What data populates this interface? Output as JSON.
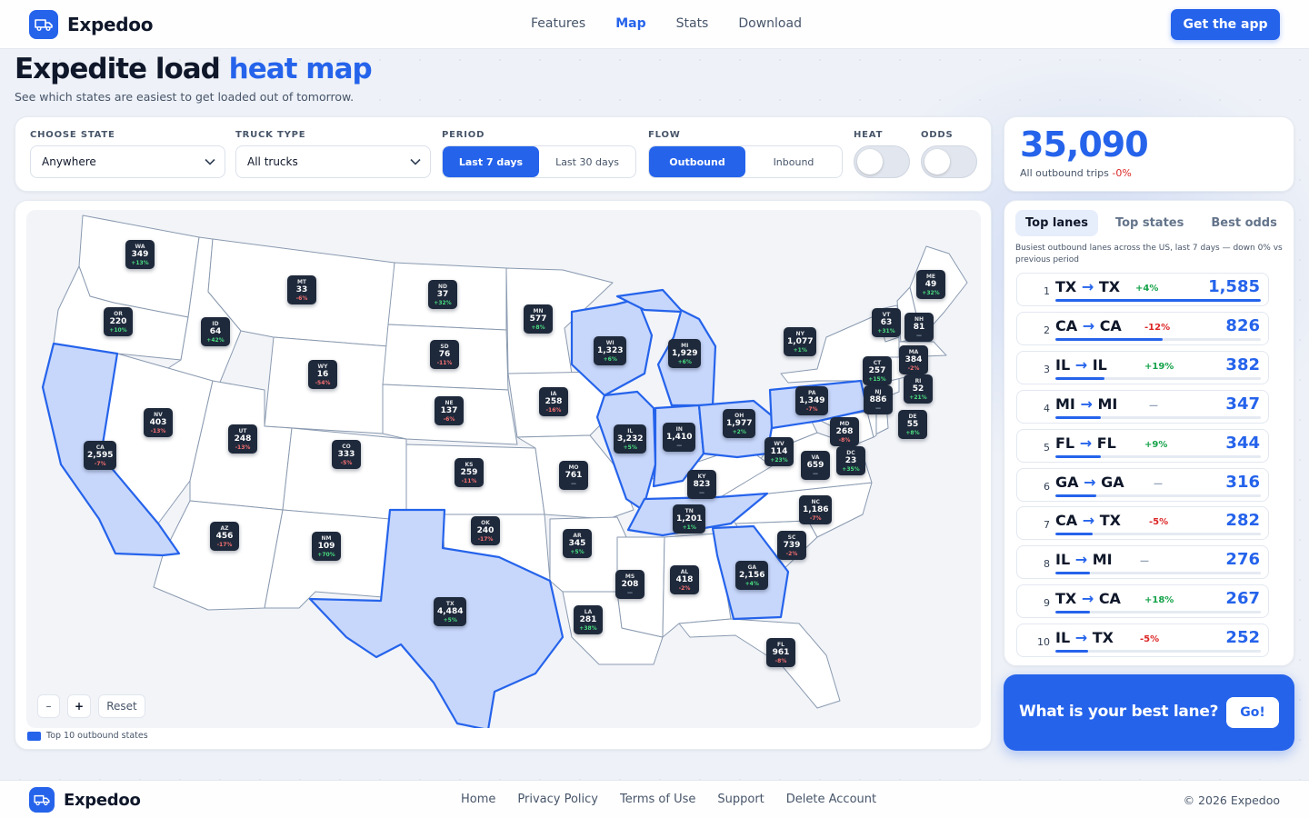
{
  "brand": {
    "name": "Expedoo",
    "accent": "#2563eb"
  },
  "nav": {
    "links": [
      "Features",
      "Map",
      "Stats",
      "Download"
    ],
    "active": "Map",
    "cta": "Get the app"
  },
  "hero": {
    "title_a": "Expedite load",
    "title_b": "heat map",
    "subtitle": "See which states are easiest to get loaded out of tomorrow."
  },
  "filters": {
    "state": {
      "label": "CHOOSE STATE",
      "value": "Anywhere"
    },
    "truck": {
      "label": "TRUCK TYPE",
      "value": "All trucks"
    },
    "period": {
      "label": "PERIOD",
      "options": [
        "Last 7 days",
        "Last 30 days"
      ],
      "selected": "Last 7 days"
    },
    "flow": {
      "label": "FLOW",
      "options": [
        "Outbound",
        "Inbound"
      ],
      "selected": "Outbound"
    },
    "heat": {
      "label": "HEAT",
      "on": false
    },
    "odds": {
      "label": "ODDS",
      "on": false
    }
  },
  "total": {
    "value": "35,090",
    "label": "All outbound trips",
    "change": "-0%"
  },
  "map": {
    "zoom_out": "–",
    "zoom_in": "+",
    "reset": "Reset",
    "legend": "Top 10 outbound states",
    "highlight_fill": "#c7d7fb",
    "highlight_stroke": "#2563eb",
    "states": [
      {
        "code": "WA",
        "value": "349",
        "change": "+13%"
      },
      {
        "code": "OR",
        "value": "220",
        "change": "+10%"
      },
      {
        "code": "CA",
        "value": "2,595",
        "change": "-7%",
        "top": true
      },
      {
        "code": "NV",
        "value": "403",
        "change": "-13%"
      },
      {
        "code": "ID",
        "value": "64",
        "change": "+42%"
      },
      {
        "code": "MT",
        "value": "33",
        "change": "-6%"
      },
      {
        "code": "WY",
        "value": "16",
        "change": "-54%"
      },
      {
        "code": "UT",
        "value": "248",
        "change": "-13%"
      },
      {
        "code": "CO",
        "value": "333",
        "change": "-5%"
      },
      {
        "code": "AZ",
        "value": "456",
        "change": "-17%"
      },
      {
        "code": "NM",
        "value": "109",
        "change": "+70%"
      },
      {
        "code": "ND",
        "value": "37",
        "change": "+32%"
      },
      {
        "code": "SD",
        "value": "76",
        "change": "-11%"
      },
      {
        "code": "NE",
        "value": "137",
        "change": "-6%"
      },
      {
        "code": "KS",
        "value": "259",
        "change": "-11%"
      },
      {
        "code": "OK",
        "value": "240",
        "change": "-17%"
      },
      {
        "code": "TX",
        "value": "4,484",
        "change": "+5%",
        "top": true
      },
      {
        "code": "MN",
        "value": "577",
        "change": "+8%"
      },
      {
        "code": "IA",
        "value": "258",
        "change": "-16%"
      },
      {
        "code": "MO",
        "value": "761",
        "change": "—"
      },
      {
        "code": "AR",
        "value": "345",
        "change": "+5%"
      },
      {
        "code": "LA",
        "value": "281",
        "change": "+38%"
      },
      {
        "code": "WI",
        "value": "1,323",
        "change": "+6%",
        "top": true
      },
      {
        "code": "IL",
        "value": "3,232",
        "change": "+5%",
        "top": true
      },
      {
        "code": "MI",
        "value": "1,929",
        "change": "+6%",
        "top": true
      },
      {
        "code": "IN",
        "value": "1,410",
        "change": "—",
        "top": true
      },
      {
        "code": "OH",
        "value": "1,977",
        "change": "+2%",
        "top": true
      },
      {
        "code": "KY",
        "value": "823",
        "change": "—"
      },
      {
        "code": "TN",
        "value": "1,201",
        "change": "+1%",
        "top": true
      },
      {
        "code": "MS",
        "value": "208",
        "change": "—"
      },
      {
        "code": "AL",
        "value": "418",
        "change": "-2%"
      },
      {
        "code": "GA",
        "value": "2,156",
        "change": "+4%",
        "top": true
      },
      {
        "code": "FL",
        "value": "961",
        "change": "-8%"
      },
      {
        "code": "SC",
        "value": "739",
        "change": "-2%"
      },
      {
        "code": "NC",
        "value": "1,186",
        "change": "-7%"
      },
      {
        "code": "VA",
        "value": "659",
        "change": "—"
      },
      {
        "code": "WV",
        "value": "114",
        "change": "+23%"
      },
      {
        "code": "PA",
        "value": "1,349",
        "change": "-7%",
        "top": true
      },
      {
        "code": "NY",
        "value": "1,077",
        "change": "+1%"
      },
      {
        "code": "VT",
        "value": "63",
        "change": "+31%"
      },
      {
        "code": "NH",
        "value": "81",
        "change": "—"
      },
      {
        "code": "ME",
        "value": "49",
        "change": "+32%"
      },
      {
        "code": "MA",
        "value": "384",
        "change": "-2%"
      },
      {
        "code": "RI",
        "value": "52",
        "change": "+21%"
      },
      {
        "code": "CT",
        "value": "257",
        "change": "+15%"
      },
      {
        "code": "NJ",
        "value": "886",
        "change": "—"
      },
      {
        "code": "DE",
        "value": "55",
        "change": "+8%"
      },
      {
        "code": "MD",
        "value": "268",
        "change": "-8%"
      },
      {
        "code": "DC",
        "value": "23",
        "change": "+35%"
      }
    ]
  },
  "lanes": {
    "tabs": [
      "Top lanes",
      "Top states",
      "Best odds"
    ],
    "active_tab": "Top lanes",
    "description": "Busiest outbound lanes across the US, last 7 days — down 0% vs previous period",
    "rows": [
      {
        "rank": "1",
        "from": "TX",
        "to": "TX",
        "change": "+4%",
        "dir": "pos",
        "value": "1,585",
        "share": 1.0
      },
      {
        "rank": "2",
        "from": "CA",
        "to": "CA",
        "change": "-12%",
        "dir": "neg",
        "value": "826",
        "share": 0.52
      },
      {
        "rank": "3",
        "from": "IL",
        "to": "IL",
        "change": "+19%",
        "dir": "pos",
        "value": "382",
        "share": 0.24
      },
      {
        "rank": "4",
        "from": "MI",
        "to": "MI",
        "change": "—",
        "dir": "flat",
        "value": "347",
        "share": 0.22
      },
      {
        "rank": "5",
        "from": "FL",
        "to": "FL",
        "change": "+9%",
        "dir": "pos",
        "value": "344",
        "share": 0.22
      },
      {
        "rank": "6",
        "from": "GA",
        "to": "GA",
        "change": "—",
        "dir": "flat",
        "value": "316",
        "share": 0.2
      },
      {
        "rank": "7",
        "from": "CA",
        "to": "TX",
        "change": "-5%",
        "dir": "neg",
        "value": "282",
        "share": 0.18
      },
      {
        "rank": "8",
        "from": "IL",
        "to": "MI",
        "change": "—",
        "dir": "flat",
        "value": "276",
        "share": 0.17
      },
      {
        "rank": "9",
        "from": "TX",
        "to": "CA",
        "change": "+18%",
        "dir": "pos",
        "value": "267",
        "share": 0.17
      },
      {
        "rank": "10",
        "from": "IL",
        "to": "TX",
        "change": "-5%",
        "dir": "neg",
        "value": "252",
        "share": 0.16
      }
    ]
  },
  "promo": {
    "question": "What is your best lane?",
    "button": "Go!"
  },
  "footer": {
    "links": [
      "Home",
      "Privacy Policy",
      "Terms of Use",
      "Support",
      "Delete Account"
    ],
    "copyright": "© 2026 Expedoo"
  }
}
